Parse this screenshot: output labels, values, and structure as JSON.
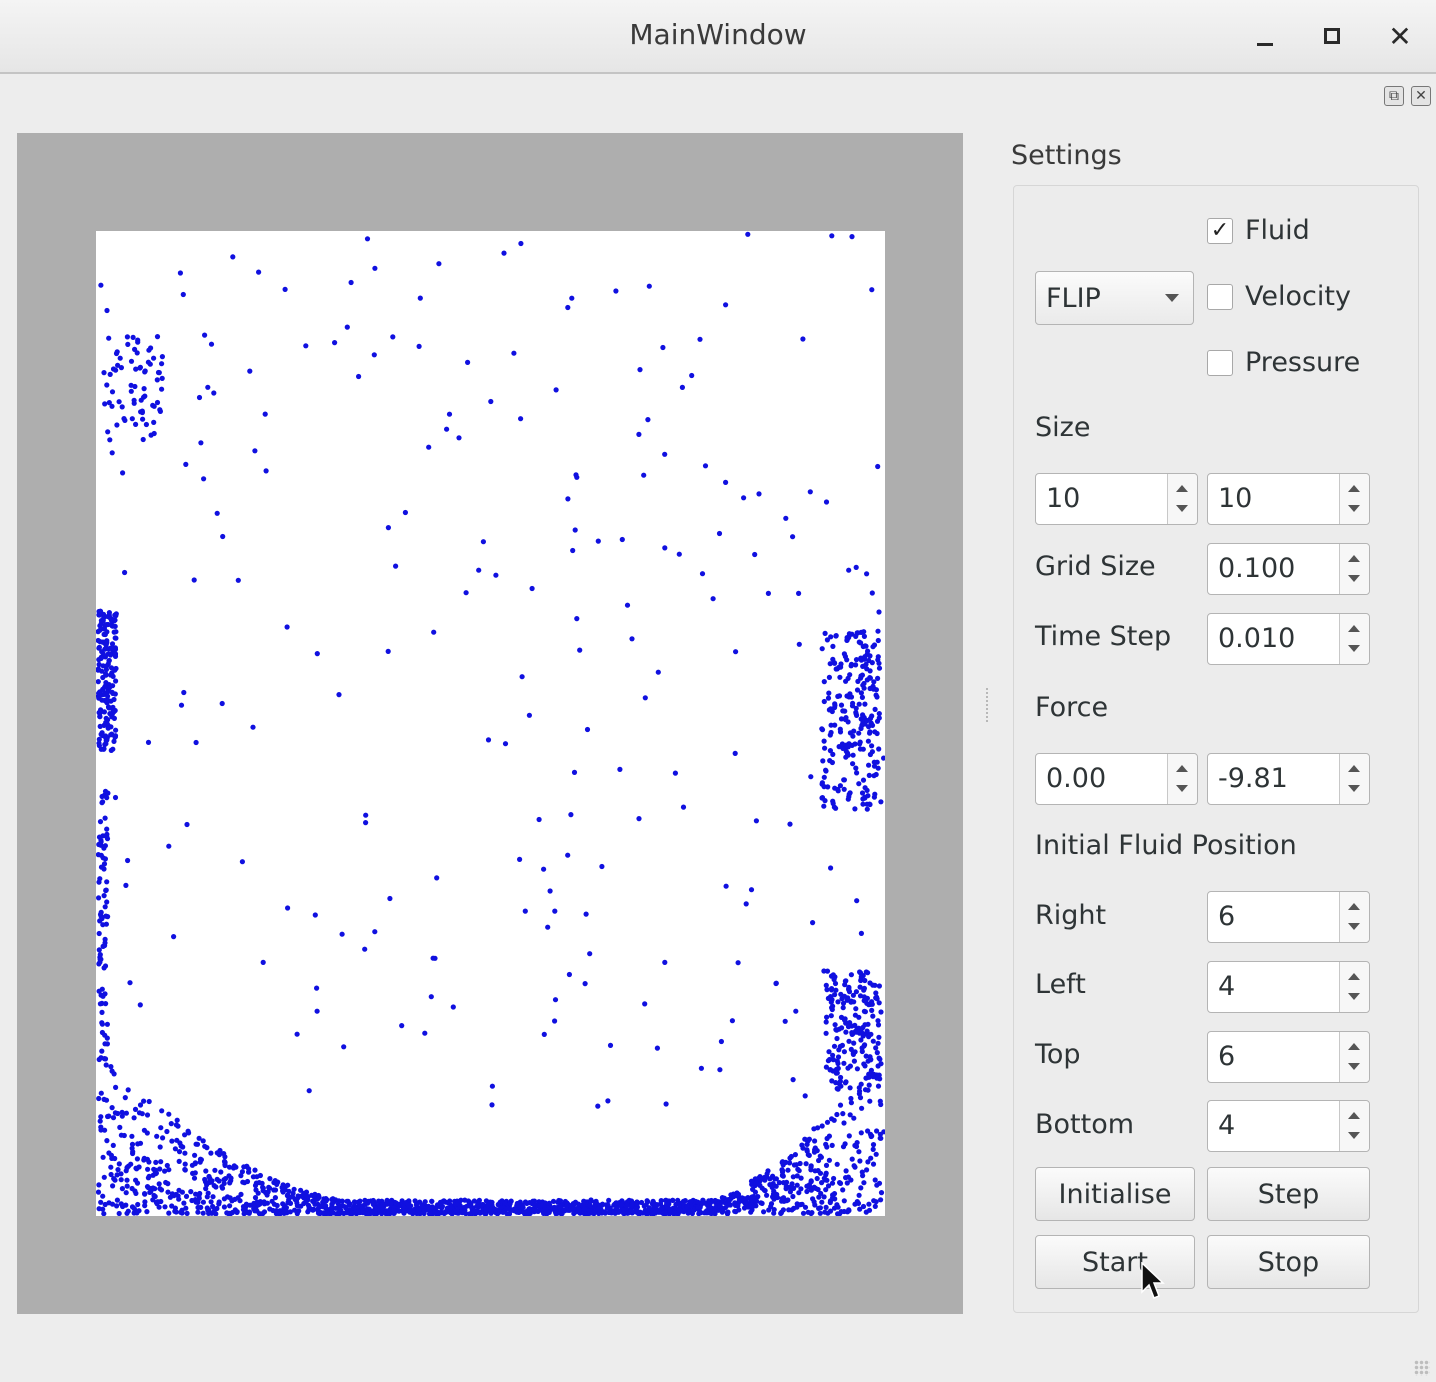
{
  "window": {
    "title": "MainWindow",
    "minimize_glyph": "–",
    "maximize_glyph": "□",
    "close_glyph": "✕"
  },
  "dock": {
    "float_glyph": "⧉",
    "close_glyph": "✕"
  },
  "settings": {
    "title": "Settings",
    "solver": {
      "selected": "FLIP"
    },
    "checkboxes": [
      {
        "label": "Fluid",
        "checked": true
      },
      {
        "label": "Velocity",
        "checked": false
      },
      {
        "label": "Pressure",
        "checked": false
      }
    ],
    "size_label": "Size",
    "size_x": "10",
    "size_y": "10",
    "grid_size_label": "Grid Size",
    "grid_size": "0.100",
    "time_step_label": "Time Step",
    "time_step": "0.010",
    "force_label": "Force",
    "force_x": "0.00",
    "force_y": "-9.81",
    "initial_position_label": "Initial Fluid Position",
    "right_label": "Right",
    "right": "6",
    "left_label": "Left",
    "left": "4",
    "top_label": "Top",
    "top": "6",
    "bottom_label": "Bottom",
    "bottom": "4",
    "buttons": {
      "initialise": "Initialise",
      "step": "Step",
      "start": "Start",
      "stop": "Stop"
    }
  },
  "colors": {
    "particle": "#1010e0",
    "sim_background": "#aeaeae",
    "canvas": "#ffffff"
  }
}
